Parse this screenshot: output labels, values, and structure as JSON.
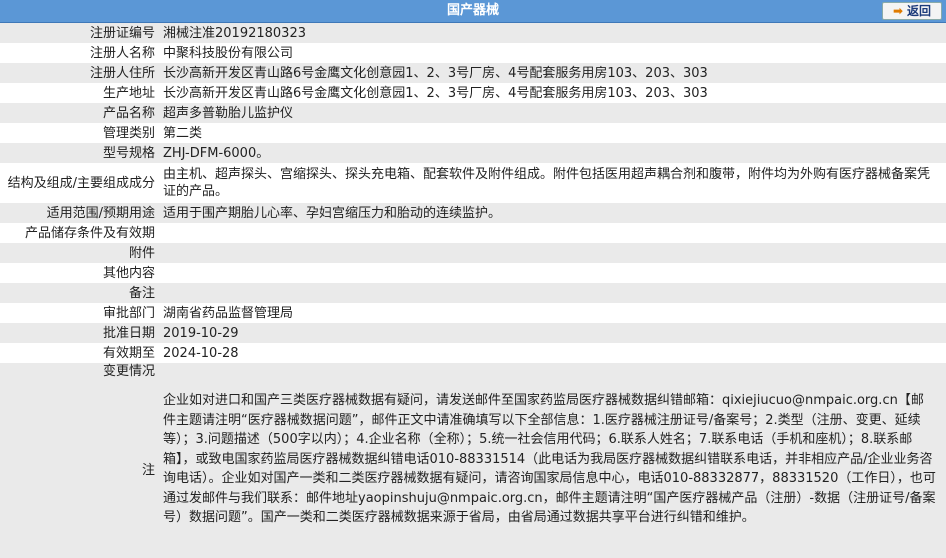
{
  "header": {
    "title": "国产器械",
    "back_label": "返回"
  },
  "rows": [
    {
      "label": "注册证编号",
      "value": "湘械注准20192180323"
    },
    {
      "label": "注册人名称",
      "value": "中聚科技股份有限公司"
    },
    {
      "label": "注册人住所",
      "value": "长沙高新开发区青山路6号金鹰文化创意园1、2、3号厂房、4号配套服务用房103、203、303"
    },
    {
      "label": "生产地址",
      "value": "长沙高新开发区青山路6号金鹰文化创意园1、2、3号厂房、4号配套服务用房103、203、303"
    },
    {
      "label": "产品名称",
      "value": "超声多普勒胎儿监护仪"
    },
    {
      "label": "管理类别",
      "value": "第二类"
    },
    {
      "label": "型号规格",
      "value": "ZHJ-DFM-6000。"
    },
    {
      "label": "结构及组成/主要组成成分",
      "value": "由主机、超声探头、宫缩探头、探头充电箱、配套软件及附件组成。附件包括医用超声耦合剂和腹带，附件均为外购有医疗器械备案凭证的产品。"
    },
    {
      "label": "适用范围/预期用途",
      "value": "适用于围产期胎儿心率、孕妇宫缩压力和胎动的连续监护。"
    },
    {
      "label": "产品储存条件及有效期",
      "value": ""
    },
    {
      "label": "附件",
      "value": ""
    },
    {
      "label": "其他内容",
      "value": ""
    },
    {
      "label": "备注",
      "value": ""
    },
    {
      "label": "审批部门",
      "value": "湖南省药品监督管理局"
    },
    {
      "label": "批准日期",
      "value": "2019-10-29"
    },
    {
      "label": "有效期至",
      "value": "2024-10-28"
    },
    {
      "label": "变更情况",
      "value": ""
    },
    {
      "label": "注",
      "value": "企业如对进口和国产三类医疗器械数据有疑问，请发送邮件至国家药监局医疗器械数据纠错邮箱：qixiejiucuo@nmpaic.org.cn【邮件主题请注明“医疗器械数据问题”，邮件正文中请准确填写以下全部信息：1.医疗器械注册证号/备案号；2.类型（注册、变更、延续等）；3.问题描述（500字以内）；4.企业名称（全称）；5.统一社会信用代码；6.联系人姓名；7.联系电话（手机和座机）；8.联系邮箱】，或致电国家药监局医疗器械数据纠错电话010-88331514（此电话为我局医疗器械数据纠错联系电话，并非相应产品/企业业务咨询电话）。企业如对国产一类和二类医疗器械数据有疑问，请咨询国家局信息中心，电话010-88332877，88331520（工作日），也可通过发邮件与我们联系：邮件地址yaopinshuju@nmpaic.org.cn，邮件主题请注明“国产医疗器械产品（注册）-数据（注册证号/备案号）数据问题”。国产一类和二类医疗器械数据来源于省局，由省局通过数据共享平台进行纠错和维护。"
    }
  ]
}
